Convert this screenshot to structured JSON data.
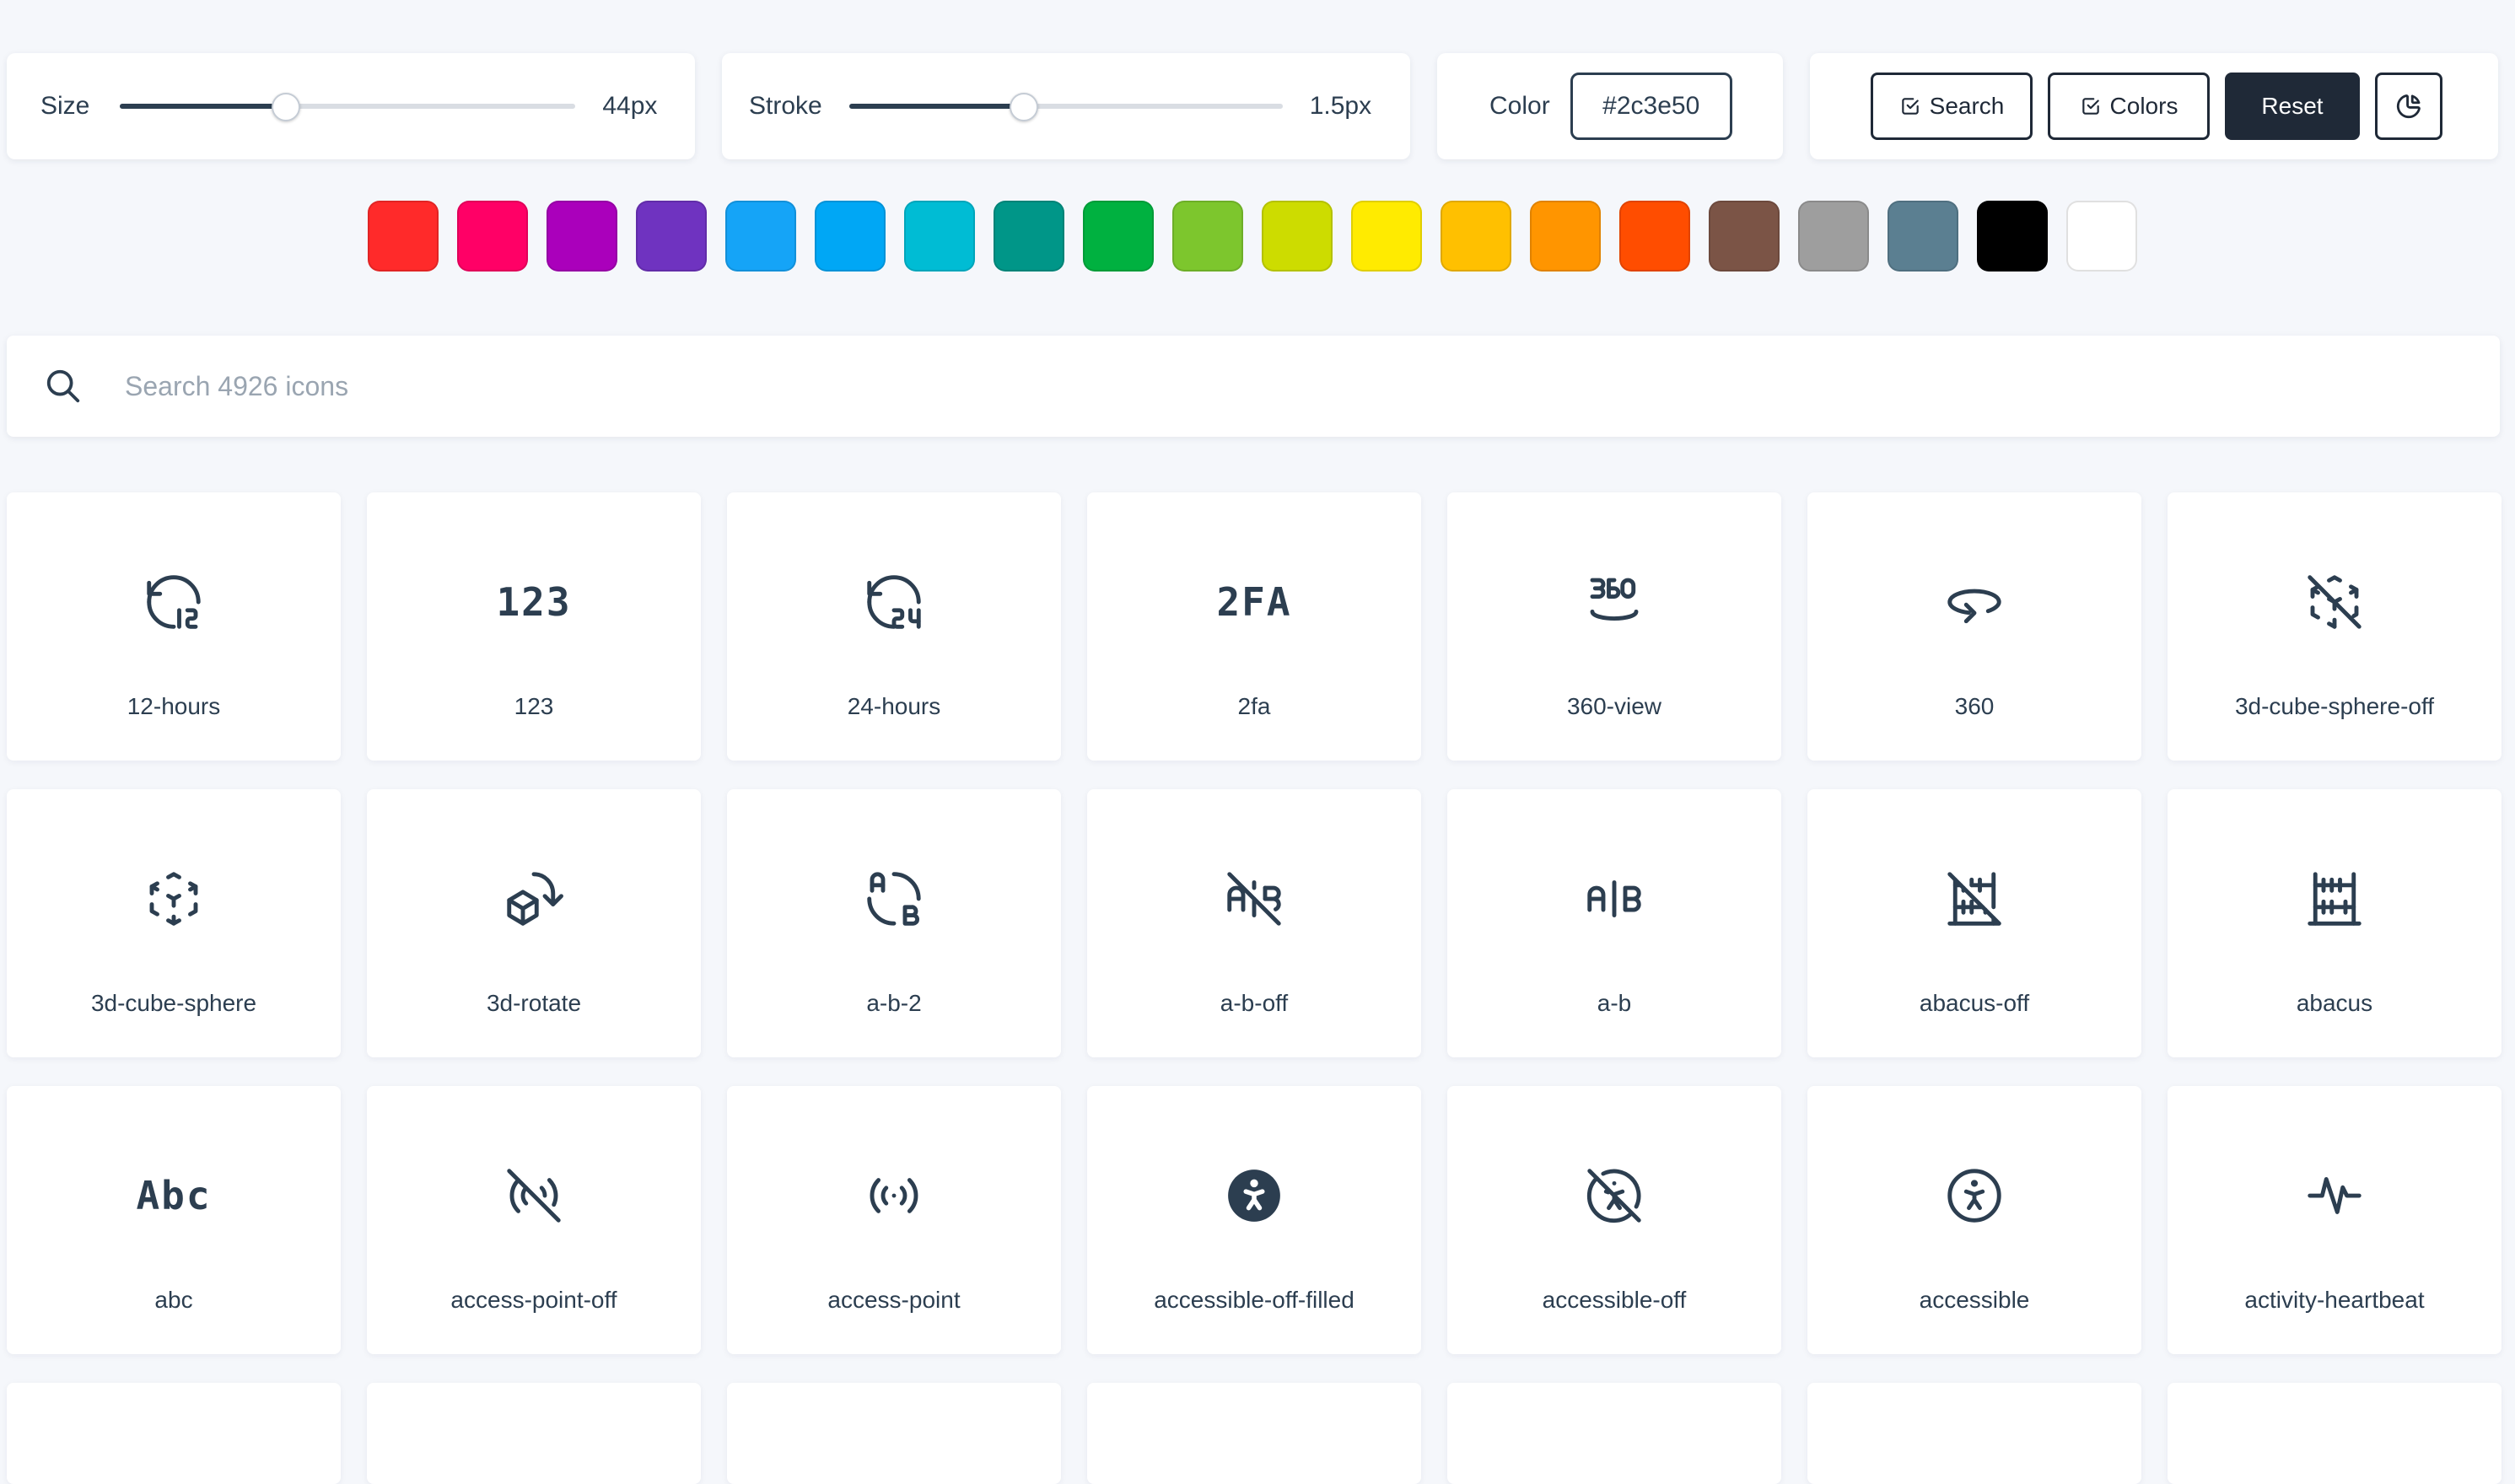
{
  "controls": {
    "size": {
      "label": "Size",
      "value": "44px",
      "fraction": 0.36
    },
    "stroke": {
      "label": "Stroke",
      "value": "1.5px",
      "fraction": 0.4
    },
    "color": {
      "label": "Color",
      "value": "#2c3e50"
    },
    "buttons": {
      "search": "Search",
      "colors": "Colors",
      "reset": "Reset"
    }
  },
  "swatches": [
    "#ff2a2a",
    "#ff0066",
    "#aa00bb",
    "#6f33c0",
    "#15a4f7",
    "#00a7f5",
    "#00bcd4",
    "#009688",
    "#00b140",
    "#7dc62d",
    "#cddc00",
    "#ffeb00",
    "#ffc000",
    "#ff9500",
    "#ff4d00",
    "#7b5446",
    "#9e9e9e",
    "#5b7f91",
    "#000000",
    "#ffffff"
  ],
  "search": {
    "placeholder": "Search 4926 icons"
  },
  "icons": [
    {
      "name": "12-hours",
      "icon": "clock-12-icon"
    },
    {
      "name": "123",
      "icon": "numbers-123-icon",
      "glyph": "123"
    },
    {
      "name": "24-hours",
      "icon": "clock-24-icon"
    },
    {
      "name": "2fa",
      "icon": "two-factor-icon",
      "glyph": "2FA"
    },
    {
      "name": "360-view",
      "icon": "view-360-icon"
    },
    {
      "name": "360",
      "icon": "rotate-360-icon"
    },
    {
      "name": "3d-cube-sphere-off",
      "icon": "cube-sphere-off-icon"
    },
    {
      "name": "3d-cube-sphere",
      "icon": "cube-sphere-icon"
    },
    {
      "name": "3d-rotate",
      "icon": "rotate-3d-icon"
    },
    {
      "name": "a-b-2",
      "icon": "a-b-2-icon"
    },
    {
      "name": "a-b-off",
      "icon": "a-b-off-icon"
    },
    {
      "name": "a-b",
      "icon": "a-b-icon"
    },
    {
      "name": "abacus-off",
      "icon": "abacus-off-icon"
    },
    {
      "name": "abacus",
      "icon": "abacus-icon"
    },
    {
      "name": "abc",
      "icon": "abc-icon",
      "glyph": "Abc"
    },
    {
      "name": "access-point-off",
      "icon": "access-point-off-icon"
    },
    {
      "name": "access-point",
      "icon": "access-point-icon"
    },
    {
      "name": "accessible-off-filled",
      "icon": "accessible-off-filled-icon"
    },
    {
      "name": "accessible-off",
      "icon": "accessible-off-icon"
    },
    {
      "name": "accessible",
      "icon": "accessible-icon"
    },
    {
      "name": "activity-heartbeat",
      "icon": "activity-heartbeat-icon"
    }
  ]
}
